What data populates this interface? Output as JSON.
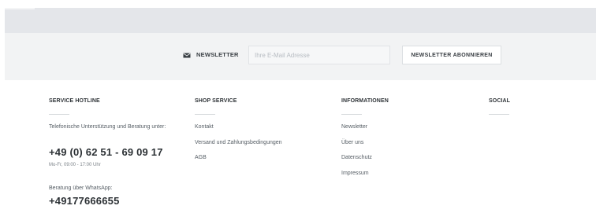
{
  "newsletter": {
    "label": "NEWSLETTER",
    "icon": "envelope-icon",
    "input_value": "",
    "input_placeholder": "Ihre E-Mail Adresse",
    "button_label": "NEWSLETTER ABONNIEREN"
  },
  "service_hotline": {
    "title": "SERVICE HOTLINE",
    "description": "Telefonische Unterstützung und Beratung unter:",
    "phone": "+49 (0) 62 51 - 69 09 17",
    "hours": "Mo-Fr, 09:00 - 17:00 Uhr",
    "whatsapp_label": "Beratung über WhatsApp:",
    "whatsapp_number": "+49177666655"
  },
  "shop_service": {
    "title": "SHOP SERVICE",
    "links": [
      "Kontakt",
      "Versand und Zahlungsbedingungen",
      "AGB"
    ]
  },
  "informationen": {
    "title": "INFORMATIONEN",
    "links": [
      "Newsletter",
      "Über uns",
      "Datenschutz",
      "Impressum"
    ]
  },
  "social": {
    "title": "SOCIAL"
  },
  "colors": {
    "top_strip": "#e4e6ea",
    "newsletter_bar": "#f2f3f4",
    "text_dark": "#2f3438"
  }
}
